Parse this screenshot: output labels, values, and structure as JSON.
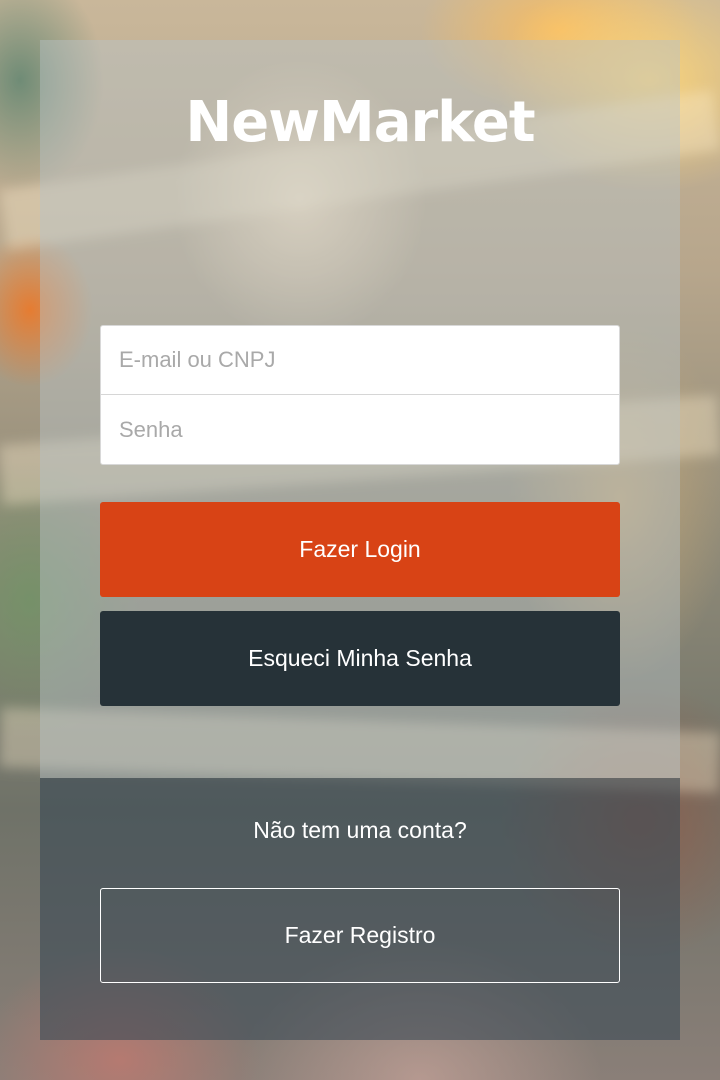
{
  "app": {
    "logo_text": "NewMarket"
  },
  "login_form": {
    "email_placeholder": "E-mail ou CNPJ",
    "password_placeholder": "Senha",
    "login_button": "Fazer Login",
    "forgot_button": "Esqueci Minha Senha"
  },
  "register": {
    "prompt": "Não tem uma conta?",
    "register_button": "Fazer Registro"
  },
  "colors": {
    "login_button": "#d84315",
    "forgot_button": "#263238",
    "field_background": "#ffffff"
  }
}
